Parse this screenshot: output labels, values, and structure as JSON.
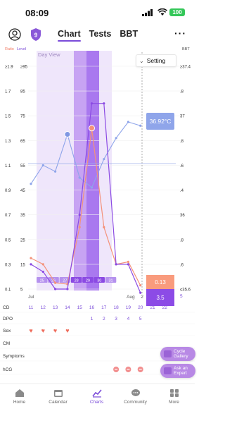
{
  "status_bar": {
    "time": "08:09",
    "battery": "100"
  },
  "header": {
    "tabs": [
      {
        "label": "Chart",
        "active": true
      },
      {
        "label": "Tests",
        "active": false
      },
      {
        "label": "BBT",
        "active": false
      }
    ],
    "more": "···",
    "shield_badge": "9"
  },
  "chart": {
    "left_axis_titles": [
      "Ratio",
      "Level"
    ],
    "right_axis_title": "BBT",
    "watermark": "Day View",
    "setting_label": "Setting",
    "ratio_ticks": [
      "≥1.9",
      "1.7",
      "1.5",
      "1.3",
      "1.1",
      "0.9",
      "0.7",
      "0.5",
      "0.3",
      "0.1"
    ],
    "level_ticks": [
      "≥95",
      "85",
      "75",
      "65",
      "55",
      "45",
      "35",
      "25",
      "15",
      "5"
    ],
    "bbt_ticks": [
      "≥37.4",
      ".8",
      "37",
      ".8",
      ".6",
      ".4",
      "36",
      ".8",
      ".6",
      "≤35.6"
    ],
    "date_strip": [
      "25",
      "26",
      "27",
      "28",
      "29",
      "30",
      "31"
    ],
    "month_labels": {
      "jul": "Jul",
      "aug": "Aug"
    },
    "x_dates": [
      "11",
      "12",
      "13",
      "14",
      "15",
      "16",
      "17",
      "18",
      "19",
      "20",
      "21",
      "22"
    ],
    "bbt_point_label": "36.92°C",
    "ratio_value_label": "0.13",
    "level_value_label": "3.5",
    "marker_value": "2",
    "colors": {
      "ratio": "#f4927a",
      "level": "#8b4ae3",
      "bbt": "#8fa5ea",
      "heart": "#ef6e5e",
      "hcg": "#f28e8e"
    }
  },
  "chart_data": {
    "type": "line",
    "x": [
      11,
      12,
      13,
      14,
      15,
      16,
      17,
      18,
      19,
      20
    ],
    "series": [
      {
        "name": "Ratio",
        "axis": "ratio",
        "values": [
          0.35,
          0.3,
          0.15,
          0.14,
          0.6,
          1.4,
          0.6,
          0.3,
          0.32,
          0.13
        ]
      },
      {
        "name": "Level",
        "axis": "level",
        "values": [
          15,
          12,
          5,
          5,
          35,
          80,
          80,
          15,
          15,
          3.5
        ]
      },
      {
        "name": "BBT",
        "axis": "bbt",
        "x": [
          11,
          12,
          13,
          14,
          15,
          16,
          17,
          18,
          19,
          20
        ],
        "values": [
          36.45,
          36.6,
          36.55,
          36.85,
          36.5,
          36.42,
          36.65,
          36.82,
          36.95,
          36.92
        ]
      }
    ],
    "ratio_range": [
      0.1,
      1.9
    ],
    "level_range": [
      5,
      95
    ],
    "bbt_range": [
      35.6,
      37.4
    ],
    "fertile_window": [
      12,
      16
    ],
    "peak_days": [
      16,
      18
    ]
  },
  "rows": {
    "labels": [
      "CD",
      "DPO",
      "Sex",
      "CM",
      "Symptoms",
      "hCG"
    ],
    "cd": [
      "11",
      "12",
      "13",
      "14",
      "15",
      "16",
      "17",
      "18",
      "19",
      "20",
      "21",
      "22"
    ],
    "dpo": [
      "1",
      "2",
      "3",
      "4",
      "5"
    ],
    "cd_bottom": "5"
  },
  "floating_buttons": [
    {
      "label": "Cycle Gallery"
    },
    {
      "label": "Ask an Expert"
    }
  ],
  "nav": [
    {
      "label": "Home",
      "icon": "home-icon"
    },
    {
      "label": "Calendar",
      "icon": "calendar-icon"
    },
    {
      "label": "Charts",
      "icon": "charts-icon",
      "active": true
    },
    {
      "label": "Community",
      "icon": "community-icon"
    },
    {
      "label": "More",
      "icon": "grid-icon"
    }
  ]
}
